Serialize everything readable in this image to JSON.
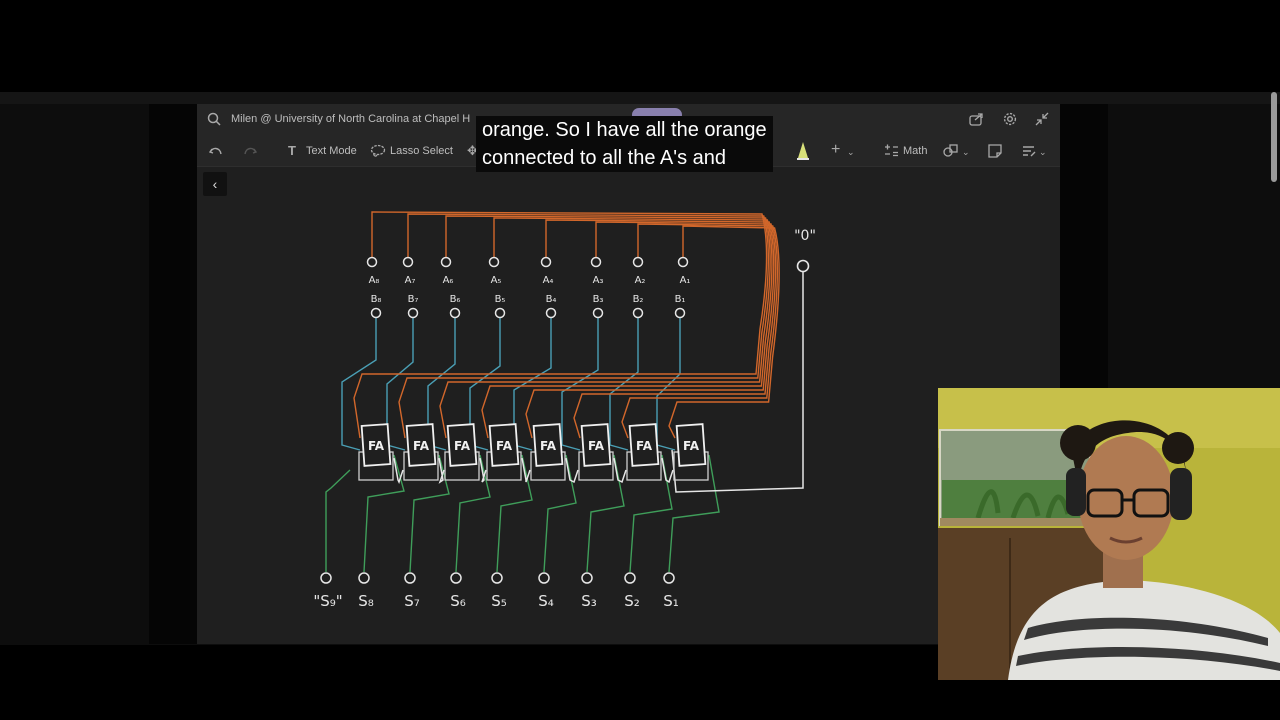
{
  "search_bar": {
    "text": "Milen @ University of North Carolina at Chapel H"
  },
  "toolbar": {
    "text_mode": "Text Mode",
    "lasso_select": "Lasso Select",
    "math": "Math"
  },
  "subtitle": {
    "line1": "orange. So I have all the orange",
    "line2": "connected to all the A's and"
  },
  "diagram": {
    "block_label": "FA",
    "inputs": [
      {
        "a": "A₈",
        "b": "B₈"
      },
      {
        "a": "A₇",
        "b": "B₇"
      },
      {
        "a": "A₆",
        "b": "B₆"
      },
      {
        "a": "A₅",
        "b": "B₅"
      },
      {
        "a": "A₄",
        "b": "B₄"
      },
      {
        "a": "A₃",
        "b": "B₃"
      },
      {
        "a": "A₂",
        "b": "B₂"
      },
      {
        "a": "A₁",
        "b": "B₁"
      }
    ],
    "carry_in_label": "\"0\"",
    "outputs": [
      "\"S₉\"",
      "S₈",
      "S₇",
      "S₆",
      "S₅",
      "S₄",
      "S₃",
      "S₂",
      "S₁"
    ]
  },
  "colors": {
    "orange_wire": "#d2672b",
    "blue_wire": "#4a9fb5",
    "green_wire": "#3f9e5a",
    "white_wire": "#e6e6e6",
    "background": "#1f1f1f"
  }
}
